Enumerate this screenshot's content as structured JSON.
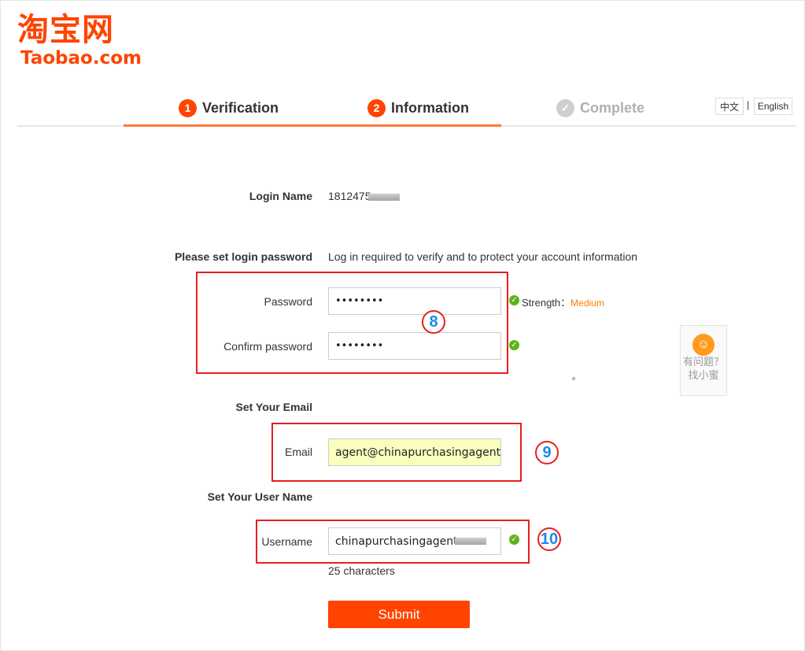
{
  "logo": {
    "cn": "淘宝网",
    "en": "Taobao.com"
  },
  "steps": [
    {
      "num": "1",
      "label": "Verification"
    },
    {
      "num": "2",
      "label": "Information"
    },
    {
      "num": "✓",
      "label": "Complete"
    }
  ],
  "lang": {
    "cn": "中文",
    "sep": "|",
    "en": "English"
  },
  "form": {
    "login_name_label": "Login Name",
    "login_name_value": "1812475",
    "password_section_label": "Please set login password",
    "password_section_note": "Log in required to verify and to protect your account information",
    "password_label": "Password",
    "password_value": "••••••••",
    "strength_label": "Strength：",
    "strength_value": "Medium",
    "confirm_label": "Confirm password",
    "confirm_value": "••••••••",
    "email_section_label": "Set Your Email",
    "email_label": "Email",
    "email_value": "agent@chinapurchasingagent.co",
    "username_section_label": "Set Your User Name",
    "username_label": "Username",
    "username_value": "chinapurchasingagent",
    "username_hint": "25 characters",
    "submit_label": "Submit"
  },
  "annotations": {
    "a8": "8",
    "a9": "9",
    "a10": "10"
  },
  "helper": {
    "line1": "有问题？",
    "line2": "找小蜜"
  },
  "colors": {
    "brand": "#ff4400",
    "accent_line": "#ff7a38",
    "annotation_red": "#e81e1e",
    "annotation_blue": "#1e88e5",
    "ok_green": "#5bb51a"
  }
}
